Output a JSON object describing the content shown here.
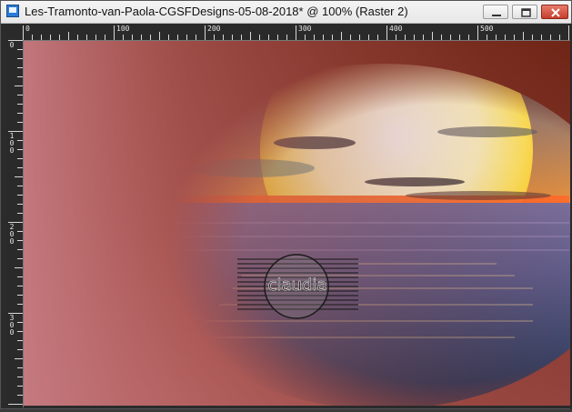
{
  "window": {
    "title": "Les-Tramonto-van-Paola-CGSFDesigns-05-08-2018* @ 100% (Raster 2)",
    "app_icon": "paintshop-image-icon",
    "controls": [
      "minimize-icon",
      "restore-icon",
      "close-icon"
    ]
  },
  "ruler": {
    "top_labels": [
      "0",
      "100",
      "200",
      "300",
      "400",
      "500"
    ],
    "left_labels": [
      "0",
      "1\n0\n0",
      "2\n0\n0",
      "3\n0\n0"
    ]
  },
  "canvas": {
    "watermark_text": "claudia",
    "colors": {
      "background_brown": "#7a2b1b",
      "frame_rose": "#b36c6c",
      "sun": "#fffbe8",
      "horizon": "#ff6a2a",
      "sea": "#5b5a86"
    }
  }
}
